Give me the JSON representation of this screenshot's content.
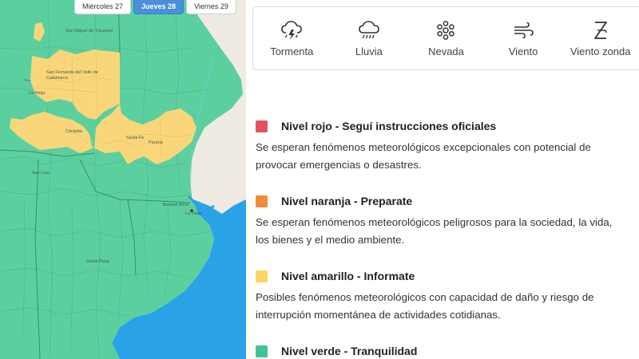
{
  "day_tabs": [
    {
      "label": "Miércoles 27",
      "active": false
    },
    {
      "label": "Jueves 28",
      "active": true
    },
    {
      "label": "Viernes 29",
      "active": false
    }
  ],
  "events": [
    {
      "label": "Tormenta",
      "icon": "storm-icon"
    },
    {
      "label": "Lluvia",
      "icon": "rain-icon"
    },
    {
      "label": "Nevada",
      "icon": "snowflake-icon"
    },
    {
      "label": "Viento",
      "icon": "wind-icon"
    },
    {
      "label": "Viento zonda",
      "icon": "zonda-wind-icon"
    }
  ],
  "levels": [
    {
      "title": "Nivel rojo - Seguí instrucciones oficiales",
      "description": "Se esperan fenómenos meteorológicos excepcionales con potencial de provocar emergencias o desastres.",
      "color": "#e05260"
    },
    {
      "title": "Nivel naranja - Preparate",
      "description": "Se esperan fenómenos meteorológicos peligrosos para la sociedad, la vida, los bienes y el medio ambiente.",
      "color": "#f28c38"
    },
    {
      "title": "Nivel amarillo - Informate",
      "description": "Posibles fenómenos meteorológicos con capacidad de daño y riesgo de interrupción momentánea de actividades cotidianas.",
      "color": "#fbd568"
    },
    {
      "title": "Nivel verde - Tranquilidad",
      "description": "",
      "color": "#3fc494"
    }
  ],
  "map": {
    "colors": {
      "green_zone": "#5ccf9f",
      "yellow_zone": "#f9d67a",
      "water": "#2aa3e6",
      "land": "#efeae2",
      "border": "#3e9e7a"
    },
    "labels": [
      "San Miguel de Tucumán",
      "San Fernando del Valle de Catamarca",
      "La Rioja",
      "Córdoba",
      "Santa Fe",
      "Paraná",
      "San Luis",
      "Buenos Aires",
      "La Plata",
      "Santa Rosa"
    ]
  }
}
